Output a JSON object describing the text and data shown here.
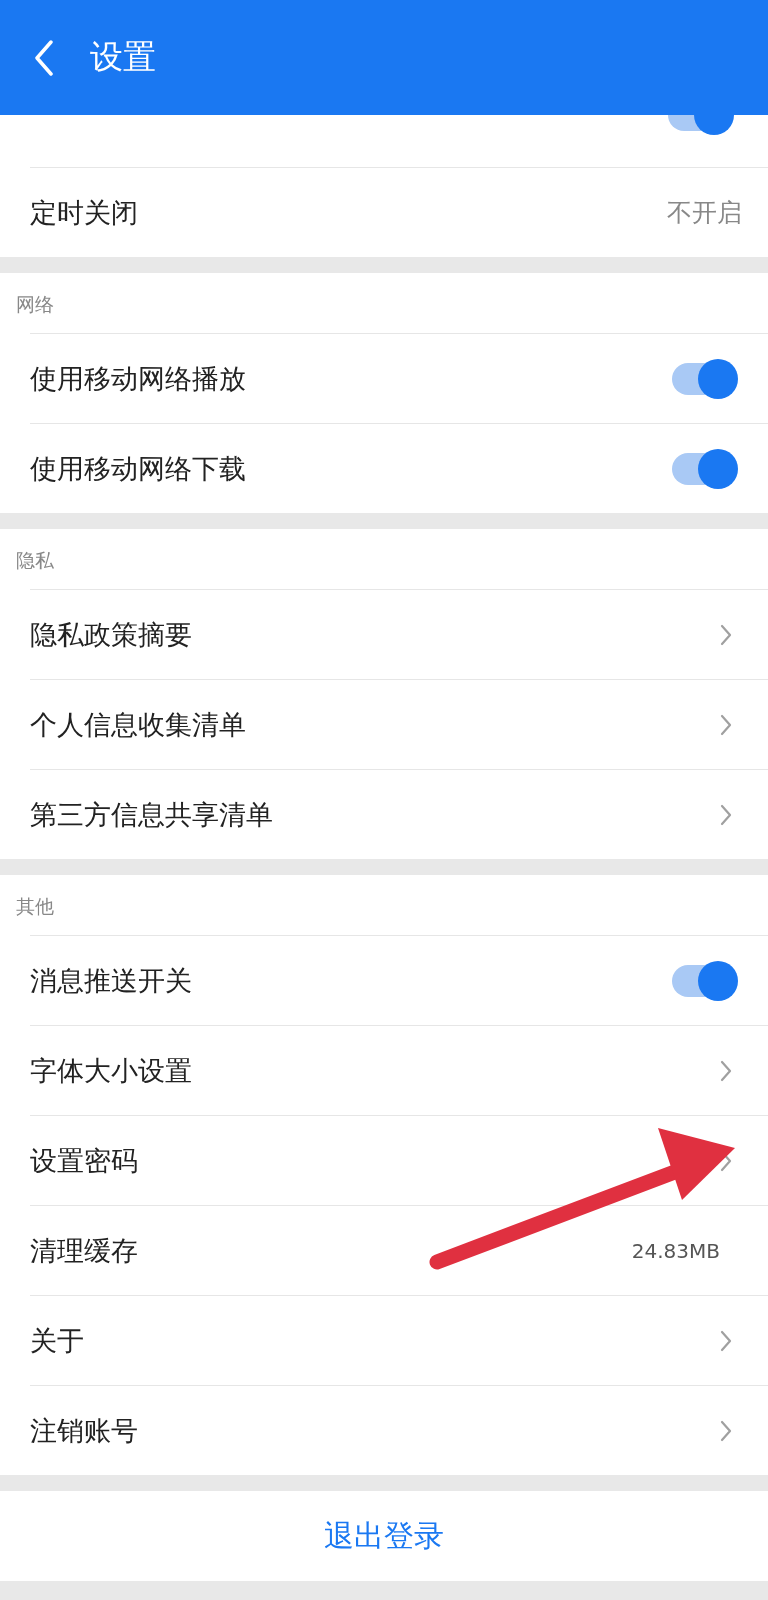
{
  "header": {
    "title": "设置"
  },
  "sections": [
    {
      "items": [
        {
          "kind": "cut-toggle",
          "on": true
        },
        {
          "label": "定时关闭",
          "kind": "value",
          "value": "不开启"
        }
      ]
    },
    {
      "label": "网络",
      "items": [
        {
          "label": "使用移动网络播放",
          "kind": "toggle",
          "on": true
        },
        {
          "label": "使用移动网络下载",
          "kind": "toggle",
          "on": true
        }
      ]
    },
    {
      "label": "隐私",
      "items": [
        {
          "label": "隐私政策摘要",
          "kind": "link"
        },
        {
          "label": "个人信息收集清单",
          "kind": "link"
        },
        {
          "label": "第三方信息共享清单",
          "kind": "link"
        }
      ]
    },
    {
      "label": "其他",
      "items": [
        {
          "label": "消息推送开关",
          "kind": "toggle",
          "on": true
        },
        {
          "label": "字体大小设置",
          "kind": "link"
        },
        {
          "label": "设置密码",
          "kind": "link"
        },
        {
          "label": "清理缓存",
          "kind": "size",
          "value": "24.83MB"
        },
        {
          "label": "关于",
          "kind": "link"
        },
        {
          "label": "注销账号",
          "kind": "link"
        }
      ]
    }
  ],
  "logout": "退出登录"
}
